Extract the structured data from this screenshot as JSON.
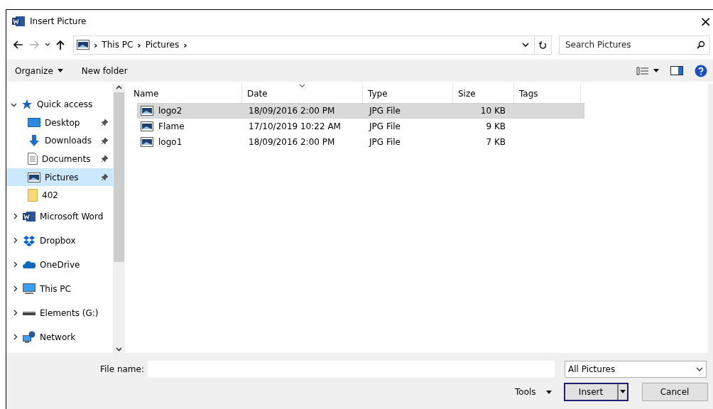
{
  "window": {
    "title": "Insert Picture",
    "close": "×"
  },
  "address": {
    "path": [
      "This PC",
      "Pictures"
    ],
    "separator": "›",
    "search_placeholder": "Search Pictures"
  },
  "toolbar": {
    "organize": "Organize",
    "new_folder": "New folder"
  },
  "sidebar": {
    "items": [
      {
        "label": "Quick access",
        "expanded": true,
        "selected": false,
        "children": [
          {
            "label": "Desktop",
            "pinned": true,
            "selected": false
          },
          {
            "label": "Downloads",
            "pinned": true,
            "selected": false
          },
          {
            "label": "Documents",
            "pinned": true,
            "selected": false
          },
          {
            "label": "Pictures",
            "pinned": true,
            "selected": true
          },
          {
            "label": "402",
            "pinned": false,
            "selected": false
          }
        ]
      },
      {
        "label": "Microsoft Word",
        "expanded": false,
        "selected": false
      },
      {
        "label": "Dropbox",
        "expanded": false,
        "selected": false
      },
      {
        "label": "OneDrive",
        "expanded": false,
        "selected": false
      },
      {
        "label": "This PC",
        "expanded": false,
        "selected": false
      },
      {
        "label": "Elements (G:)",
        "expanded": false,
        "selected": false
      },
      {
        "label": "Network",
        "expanded": false,
        "selected": false
      }
    ]
  },
  "table": {
    "columns": [
      {
        "label": "Name",
        "sorted": false
      },
      {
        "label": "Date",
        "sorted": true
      },
      {
        "label": "Type",
        "sorted": false
      },
      {
        "label": "Size",
        "sorted": false
      },
      {
        "label": "Tags",
        "sorted": false
      }
    ],
    "rows": [
      {
        "name": "logo2",
        "date": "18/09/2016 2:00 PM",
        "type": "JPG File",
        "size": "10 KB",
        "selected": true
      },
      {
        "name": "Flame",
        "date": "17/10/2019 10:22 AM",
        "type": "JPG File",
        "size": "9 KB",
        "selected": false
      },
      {
        "name": "logo1",
        "date": "18/09/2016 2:00 PM",
        "type": "JPG File",
        "size": "7 KB",
        "selected": false
      }
    ]
  },
  "footer": {
    "file_name_label": "File name:",
    "filter": "All Pictures",
    "tools": "Tools",
    "insert": "Insert",
    "cancel": "Cancel"
  }
}
